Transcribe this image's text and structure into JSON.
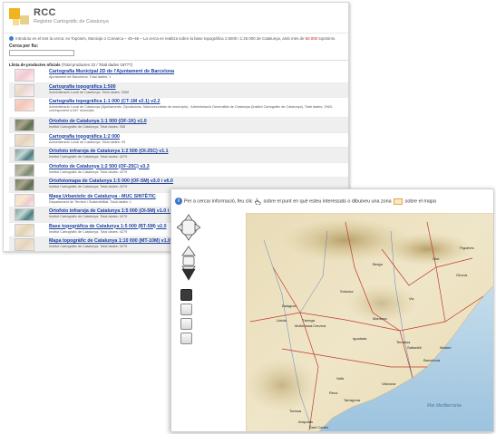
{
  "header": {
    "logo_title": "RCC",
    "logo_subtitle": "Registre Cartogràfic de Catalunya"
  },
  "info": {
    "text_start": "Introduïu en el text la cerca: ",
    "text_main": "ex Topònim, Municipi o Comarca – 45–46 – La cerca es realitza sobre la base topogràfica 1:5000 i 1:25 000 de Catalunya, amb més de ",
    "text_red": "60.000",
    "text_end": " topònims."
  },
  "search": {
    "label": "Cerca per fiu:",
    "value": ""
  },
  "list": {
    "title": "Llista de productes oficials",
    "summary": " (Total productes 22 / Total dades 19777)"
  },
  "products": [
    {
      "title": "Cartografia Municipal 2D de l'Ajuntament de Barcelona",
      "meta": "Ajuntament de Barcelona. Total dades: 1",
      "thumb": "t-pink"
    },
    {
      "title": "Cartografia topogràfica 1:500",
      "meta": "Administració Local de Catalunya. Total dades: 2066",
      "thumb": "t-map"
    },
    {
      "title": "Cartografia topogràfica 1:1 000 (CT-1M v2.1) v2.2",
      "meta": "Administració Local de Catalunya (Ajuntaments, Diputacions, Mancomunitats de municipis) - Administració Generalitat de Catalunya (Institut Cartogràfic de Catalunya). Total dades: 2963, corresponent a 847 municipis",
      "thumb": "t-red",
      "tall": true
    },
    {
      "title": "Ortofoto de Catalunya 1:1 000 (OF-1K) v1.0",
      "meta": "Institut Cartogràfic de Catalunya. Total dades: 336",
      "thumb": "t-ortho"
    },
    {
      "title": "Cartografia topogràfica 1:2 000",
      "meta": "Administració Local de Catalunya. Total dades: 93",
      "thumb": "t-map2"
    },
    {
      "title": "Ortofoto infraroja de Catalunya 1:2 500 (OI-25C) v1.1",
      "meta": "Institut Cartogràfic de Catalunya. Total dades: 4279",
      "thumb": "t-ir"
    },
    {
      "title": "Ortofoto de Catalunya 1:2 500 (OF-25C) v3.3",
      "meta": "Institut Cartogràfic de Catalunya. Total dades: 4279",
      "thumb": "t-ortho2"
    },
    {
      "title": "Ortofotomapa de Catalunya 1:5 000 (OF-5M) v3.0 i v6.0",
      "meta": "Institut Cartogràfic de Catalunya. Total dades: 4279",
      "thumb": "t-ortho"
    },
    {
      "title": "Mapa Urbanístic de Catalunya - MUC SINTÈTIC",
      "meta": "Departament de Territori i Sostenibilitat. Total dades: 1",
      "thumb": "t-urb"
    },
    {
      "title": "Ortofoto infraroja de Catalunya 1:5 000 (OI-5M) v1.0 i v2.0",
      "meta": "Institut Cartogràfic de Catalunya. Total dades: 4279",
      "thumb": "t-ir"
    },
    {
      "title": "Base topogràfica de Catalunya 1:5 000 (BT-5M) v2.0",
      "meta": "Institut Cartogràfic de Catalunya. Total dades: 4279",
      "thumb": "t-topo"
    },
    {
      "title": "Mapa topogràfic de Catalunya 1:10 000 (MT-10M) v1.0 i v2.1",
      "meta": "Institut Cartogràfic de Catalunya. Total dades: 4279",
      "thumb": "t-map2"
    }
  ],
  "viewer": {
    "help_start": "Per a cercar informació, feu clic ",
    "help_mid": " sobre el punt en què esteu interessats o dibuixeu una zona ",
    "help_end": " sobre el mapa"
  },
  "map": {
    "places": [
      "Lleida",
      "Girona",
      "Barcelona",
      "Tarragona",
      "Manresa",
      "Vic",
      "Reus",
      "Figueres",
      "Olot",
      "Tortosa",
      "Igualada",
      "Sabadell",
      "Terrassa",
      "Mataró",
      "Vilanova",
      "Berga",
      "Solsona",
      "Cervera",
      "Tàrrega",
      "Balaguer",
      "Mollerussa",
      "Valls",
      "Amposta",
      "Sant Carles",
      "Mar Mediterrània"
    ]
  }
}
